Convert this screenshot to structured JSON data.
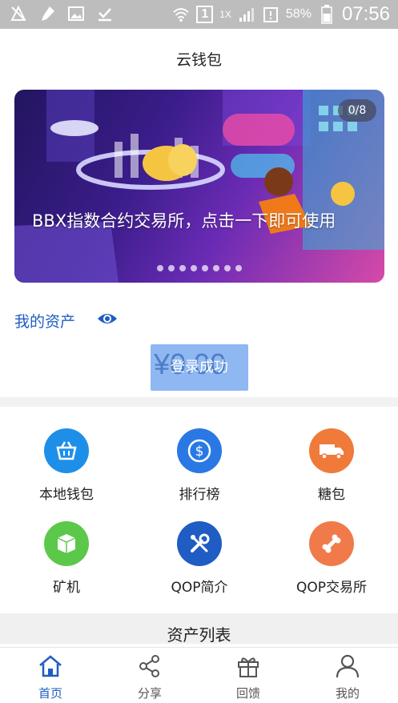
{
  "status_bar": {
    "sim_label": "1",
    "network": "1X",
    "battery": "58%",
    "time": "07:56"
  },
  "header": {
    "title": "云钱包"
  },
  "banner": {
    "counter": "0/8",
    "caption": "BBX指数合约交易所，点击一下即可使用",
    "dot_count": 8
  },
  "assets": {
    "label": "我的资产",
    "balance": "¥0.00",
    "toast": "登录成功"
  },
  "grid": [
    {
      "label": "本地钱包",
      "icon": "basket-icon",
      "color": "#1e8fe8"
    },
    {
      "label": "排行榜",
      "icon": "dollar-icon",
      "color": "#2a78e4"
    },
    {
      "label": "糖包",
      "icon": "truck-icon",
      "color": "#f07a3a"
    },
    {
      "label": "矿机",
      "icon": "box-icon",
      "color": "#5cc84a"
    },
    {
      "label": "QOP简介",
      "icon": "tools-icon",
      "color": "#1f5cc4"
    },
    {
      "label": "QOP交易所",
      "icon": "bone-icon",
      "color": "#f07a4a"
    }
  ],
  "asset_list": {
    "title": "资产列表"
  },
  "tabs": [
    {
      "label": "首页",
      "icon": "home-icon",
      "active": true
    },
    {
      "label": "分享",
      "icon": "share-icon",
      "active": false
    },
    {
      "label": "回馈",
      "icon": "gift-icon",
      "active": false
    },
    {
      "label": "我的",
      "icon": "user-icon",
      "active": false
    }
  ],
  "colors": {
    "accent": "#1f5cc4",
    "inactive": "#555555"
  }
}
